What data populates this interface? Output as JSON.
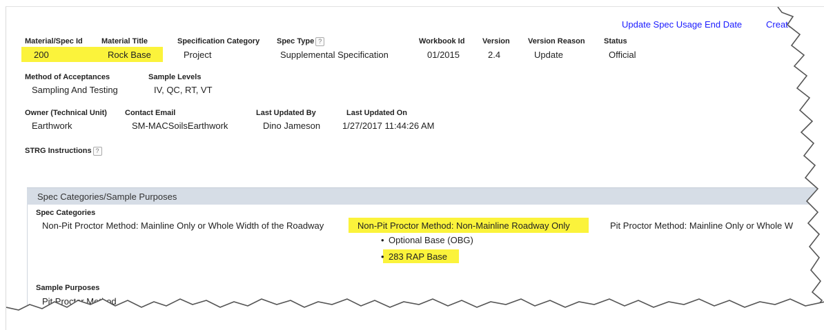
{
  "header_links": {
    "update_spec_usage": "Update Spec Usage End Date",
    "create": "Create N"
  },
  "row1": {
    "labels": {
      "material_spec_id": "Material/Spec Id",
      "material_title": "Material Title",
      "spec_category": "Specification Category",
      "spec_type": "Spec Type",
      "workbook_id": "Workbook Id",
      "version": "Version",
      "version_reason": "Version Reason",
      "status": "Status"
    },
    "values": {
      "material_spec_id": "200",
      "material_title": "Rock Base",
      "spec_category": "Project",
      "spec_type": "Supplemental Specification",
      "workbook_id": "01/2015",
      "version": "2.4",
      "version_reason": "Update",
      "status": "Official"
    }
  },
  "row2": {
    "labels": {
      "method_of_acceptances": "Method of Acceptances",
      "sample_levels": "Sample Levels"
    },
    "values": {
      "method_of_acceptances": "Sampling And Testing",
      "sample_levels": "IV, QC, RT, VT"
    }
  },
  "row3": {
    "labels": {
      "owner": "Owner (Technical Unit)",
      "contact_email": "Contact Email",
      "last_updated_by": "Last Updated By",
      "last_updated_on": "Last Updated On"
    },
    "values": {
      "owner": "Earthwork",
      "contact_email": "SM-MACSoilsEarthwork",
      "last_updated_by": "Dino Jameson",
      "last_updated_on": "1/27/2017 11:44:26 AM"
    }
  },
  "strg": {
    "label": "STRG Instructions"
  },
  "help_glyph": "?",
  "section": {
    "title": "Spec Categories/Sample Purposes",
    "spec_categories_label": "Spec Categories",
    "categories": [
      "Non-Pit Proctor Method: Mainline Only or Whole Width of the Roadway",
      "Non-Pit Proctor Method: Non-Mainline Roadway Only",
      "Pit Proctor Method: Mainline Only or Whole W"
    ],
    "sub_items": [
      "Optional Base (OBG)",
      "283 RAP Base"
    ],
    "sample_purposes_label": "Sample Purposes",
    "sample_purposes_item": "Pit Proctor Method"
  },
  "colors": {
    "highlight": "#fbf33b",
    "link": "#1a1aff",
    "section_bar": "#d6dde6"
  }
}
